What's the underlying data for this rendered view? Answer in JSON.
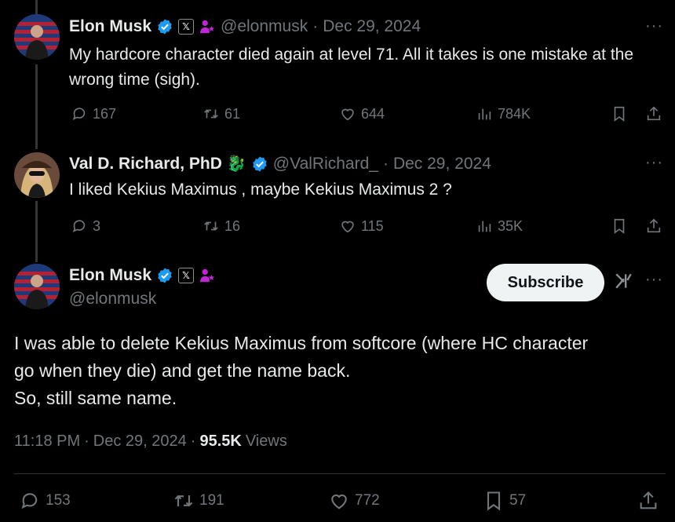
{
  "tweets": [
    {
      "name": "Elon Musk",
      "handle": "@elonmusk",
      "separator": "·",
      "date": "Dec 29, 2024",
      "text": "My hardcore character died again at level 71. All it takes is one mistake at the wrong time (sigh).",
      "replies": "167",
      "retweets": "61",
      "likes": "644",
      "views": "784K"
    },
    {
      "name": "Val D. Richard, PhD",
      "emoji": "🐉",
      "handle": "@ValRichard_",
      "separator": "·",
      "date": "Dec 29, 2024",
      "text": "I liked Kekius Maximus , maybe Kekius Maximus 2 ?",
      "replies": "3",
      "retweets": "16",
      "likes": "115",
      "views": "35K"
    }
  ],
  "main": {
    "name": "Elon Musk",
    "handle": "@elonmusk",
    "subscribe_label": "Subscribe",
    "text_line1": "I was able to delete Kekius Maximus from softcore (where HC character",
    "text_line2": "go when they die) and get the name back.",
    "text_line3": "So, still same name.",
    "time": "11:18 PM",
    "sep1": "·",
    "date": "Dec 29, 2024",
    "sep2": "·",
    "views_count": "95.5K",
    "views_label": "Views",
    "replies": "153",
    "retweets": "191",
    "likes": "772",
    "bookmarks": "57"
  },
  "more_label": "···",
  "x_badge": "𝕏",
  "colors": {
    "verified": "#1d9bf0",
    "muted": "#71767b",
    "text": "#e7e9ea",
    "bg": "#000000",
    "affiliate": "#c026d3"
  }
}
